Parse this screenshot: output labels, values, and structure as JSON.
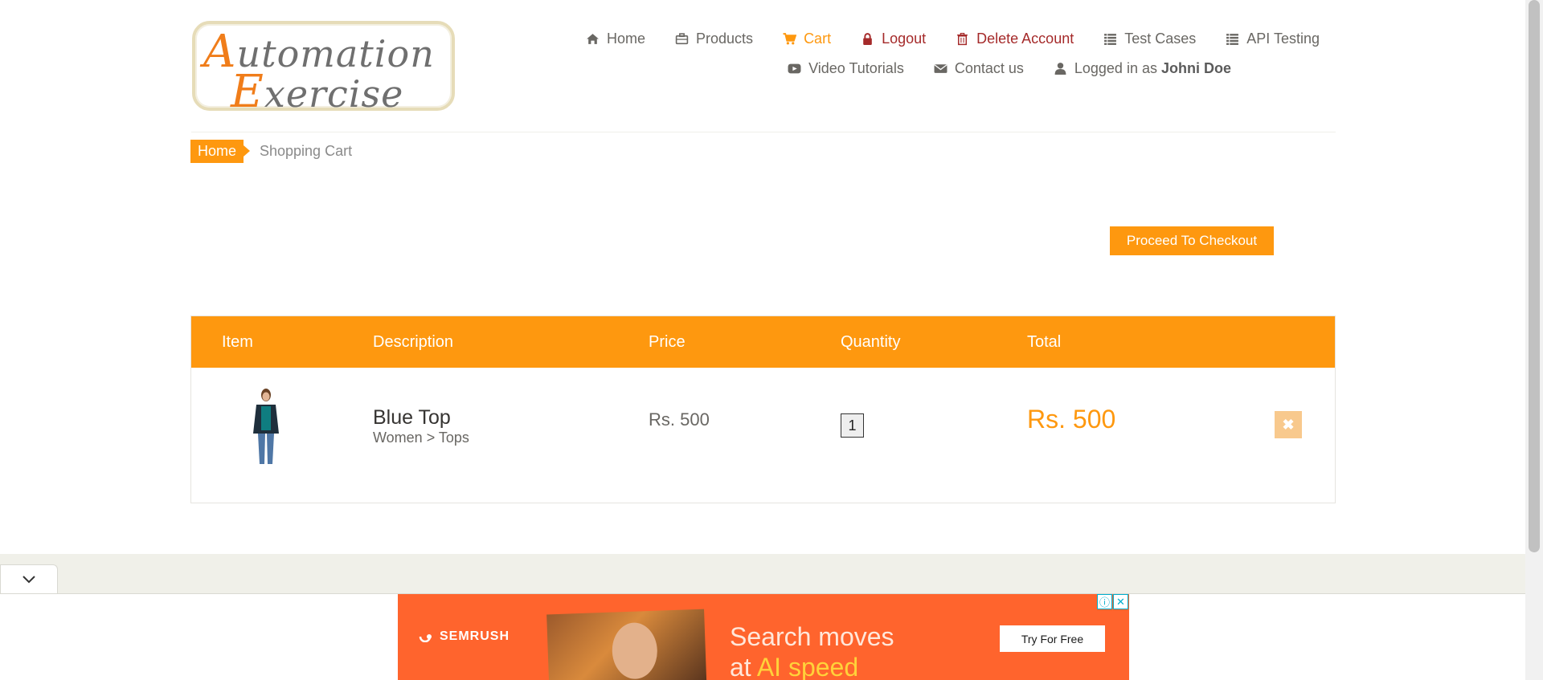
{
  "header": {
    "logo": {
      "line1": "Automation",
      "line2": "Exercise"
    },
    "nav_row1": [
      {
        "label": "Home",
        "icon": "home-icon"
      },
      {
        "label": "Products",
        "icon": "briefcase-icon"
      },
      {
        "label": "Cart",
        "icon": "cart-icon"
      },
      {
        "label": "Logout",
        "icon": "lock-icon"
      },
      {
        "label": "Delete Account",
        "icon": "trash-icon"
      },
      {
        "label": "Test Cases",
        "icon": "list-icon"
      },
      {
        "label": "API Testing",
        "icon": "list-icon"
      }
    ],
    "nav_row2": [
      {
        "label": "Video Tutorials",
        "icon": "youtube-icon"
      },
      {
        "label": "Contact us",
        "icon": "envelope-icon"
      }
    ],
    "logged_in_prefix": "Logged in as",
    "logged_in_user": "Johni Doe"
  },
  "breadcrumb": {
    "home": "Home",
    "current": "Shopping Cart"
  },
  "checkout_button": "Proceed To Checkout",
  "cart": {
    "columns": [
      "Item",
      "Description",
      "Price",
      "Quantity",
      "Total"
    ],
    "rows": [
      {
        "name": "Blue Top",
        "category": "Women > Tops",
        "price": "Rs. 500",
        "quantity": "1",
        "total": "Rs. 500"
      }
    ]
  },
  "ad": {
    "brand": "SEMRUSH",
    "headline_1": "Search moves",
    "headline_2_prefix": "at",
    "headline_2_highlight": "AI speed",
    "cta": "Try For Free"
  },
  "colors": {
    "accent": "#fe980f",
    "danger": "#a52a2a",
    "ad_bg": "#ff642d"
  }
}
